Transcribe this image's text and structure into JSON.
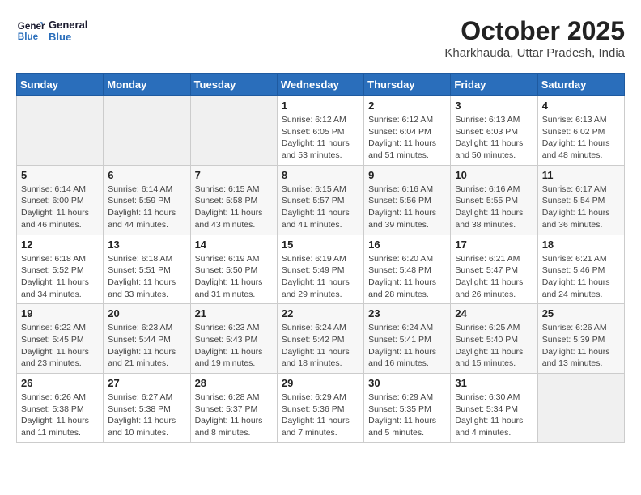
{
  "header": {
    "logo_line1": "General",
    "logo_line2": "Blue",
    "month": "October 2025",
    "location": "Kharkhauda, Uttar Pradesh, India"
  },
  "weekdays": [
    "Sunday",
    "Monday",
    "Tuesday",
    "Wednesday",
    "Thursday",
    "Friday",
    "Saturday"
  ],
  "weeks": [
    [
      {
        "day": "",
        "info": ""
      },
      {
        "day": "",
        "info": ""
      },
      {
        "day": "",
        "info": ""
      },
      {
        "day": "1",
        "info": "Sunrise: 6:12 AM\nSunset: 6:05 PM\nDaylight: 11 hours\nand 53 minutes."
      },
      {
        "day": "2",
        "info": "Sunrise: 6:12 AM\nSunset: 6:04 PM\nDaylight: 11 hours\nand 51 minutes."
      },
      {
        "day": "3",
        "info": "Sunrise: 6:13 AM\nSunset: 6:03 PM\nDaylight: 11 hours\nand 50 minutes."
      },
      {
        "day": "4",
        "info": "Sunrise: 6:13 AM\nSunset: 6:02 PM\nDaylight: 11 hours\nand 48 minutes."
      }
    ],
    [
      {
        "day": "5",
        "info": "Sunrise: 6:14 AM\nSunset: 6:00 PM\nDaylight: 11 hours\nand 46 minutes."
      },
      {
        "day": "6",
        "info": "Sunrise: 6:14 AM\nSunset: 5:59 PM\nDaylight: 11 hours\nand 44 minutes."
      },
      {
        "day": "7",
        "info": "Sunrise: 6:15 AM\nSunset: 5:58 PM\nDaylight: 11 hours\nand 43 minutes."
      },
      {
        "day": "8",
        "info": "Sunrise: 6:15 AM\nSunset: 5:57 PM\nDaylight: 11 hours\nand 41 minutes."
      },
      {
        "day": "9",
        "info": "Sunrise: 6:16 AM\nSunset: 5:56 PM\nDaylight: 11 hours\nand 39 minutes."
      },
      {
        "day": "10",
        "info": "Sunrise: 6:16 AM\nSunset: 5:55 PM\nDaylight: 11 hours\nand 38 minutes."
      },
      {
        "day": "11",
        "info": "Sunrise: 6:17 AM\nSunset: 5:54 PM\nDaylight: 11 hours\nand 36 minutes."
      }
    ],
    [
      {
        "day": "12",
        "info": "Sunrise: 6:18 AM\nSunset: 5:52 PM\nDaylight: 11 hours\nand 34 minutes."
      },
      {
        "day": "13",
        "info": "Sunrise: 6:18 AM\nSunset: 5:51 PM\nDaylight: 11 hours\nand 33 minutes."
      },
      {
        "day": "14",
        "info": "Sunrise: 6:19 AM\nSunset: 5:50 PM\nDaylight: 11 hours\nand 31 minutes."
      },
      {
        "day": "15",
        "info": "Sunrise: 6:19 AM\nSunset: 5:49 PM\nDaylight: 11 hours\nand 29 minutes."
      },
      {
        "day": "16",
        "info": "Sunrise: 6:20 AM\nSunset: 5:48 PM\nDaylight: 11 hours\nand 28 minutes."
      },
      {
        "day": "17",
        "info": "Sunrise: 6:21 AM\nSunset: 5:47 PM\nDaylight: 11 hours\nand 26 minutes."
      },
      {
        "day": "18",
        "info": "Sunrise: 6:21 AM\nSunset: 5:46 PM\nDaylight: 11 hours\nand 24 minutes."
      }
    ],
    [
      {
        "day": "19",
        "info": "Sunrise: 6:22 AM\nSunset: 5:45 PM\nDaylight: 11 hours\nand 23 minutes."
      },
      {
        "day": "20",
        "info": "Sunrise: 6:23 AM\nSunset: 5:44 PM\nDaylight: 11 hours\nand 21 minutes."
      },
      {
        "day": "21",
        "info": "Sunrise: 6:23 AM\nSunset: 5:43 PM\nDaylight: 11 hours\nand 19 minutes."
      },
      {
        "day": "22",
        "info": "Sunrise: 6:24 AM\nSunset: 5:42 PM\nDaylight: 11 hours\nand 18 minutes."
      },
      {
        "day": "23",
        "info": "Sunrise: 6:24 AM\nSunset: 5:41 PM\nDaylight: 11 hours\nand 16 minutes."
      },
      {
        "day": "24",
        "info": "Sunrise: 6:25 AM\nSunset: 5:40 PM\nDaylight: 11 hours\nand 15 minutes."
      },
      {
        "day": "25",
        "info": "Sunrise: 6:26 AM\nSunset: 5:39 PM\nDaylight: 11 hours\nand 13 minutes."
      }
    ],
    [
      {
        "day": "26",
        "info": "Sunrise: 6:26 AM\nSunset: 5:38 PM\nDaylight: 11 hours\nand 11 minutes."
      },
      {
        "day": "27",
        "info": "Sunrise: 6:27 AM\nSunset: 5:38 PM\nDaylight: 11 hours\nand 10 minutes."
      },
      {
        "day": "28",
        "info": "Sunrise: 6:28 AM\nSunset: 5:37 PM\nDaylight: 11 hours\nand 8 minutes."
      },
      {
        "day": "29",
        "info": "Sunrise: 6:29 AM\nSunset: 5:36 PM\nDaylight: 11 hours\nand 7 minutes."
      },
      {
        "day": "30",
        "info": "Sunrise: 6:29 AM\nSunset: 5:35 PM\nDaylight: 11 hours\nand 5 minutes."
      },
      {
        "day": "31",
        "info": "Sunrise: 6:30 AM\nSunset: 5:34 PM\nDaylight: 11 hours\nand 4 minutes."
      },
      {
        "day": "",
        "info": ""
      }
    ]
  ]
}
